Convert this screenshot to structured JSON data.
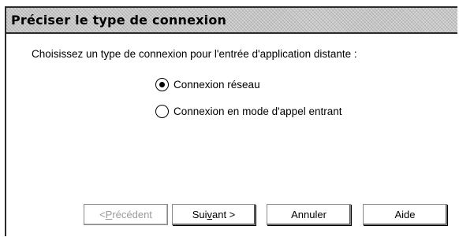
{
  "dialog": {
    "title": "Préciser le type de connexion",
    "instruction": "Choisissez un type de connexion pour l'entrée d'application distante :"
  },
  "options": [
    {
      "label": "Connexion réseau",
      "selected": true
    },
    {
      "label": "Connexion en mode d'appel entrant",
      "selected": false
    }
  ],
  "buttons": {
    "previous": {
      "prefix": "< ",
      "mnemonic": "P",
      "rest": "récédent",
      "enabled": false
    },
    "next": {
      "prefix": "Sui",
      "mnemonic": "v",
      "rest": "ant >",
      "enabled": true
    },
    "cancel": {
      "label": "Annuler",
      "enabled": true
    },
    "help": {
      "label": "Aide",
      "enabled": true
    }
  },
  "colors": {
    "titlebar": "#c8c8c8",
    "border": "#2a2a2a",
    "disabled_text": "#9a9a9a"
  }
}
